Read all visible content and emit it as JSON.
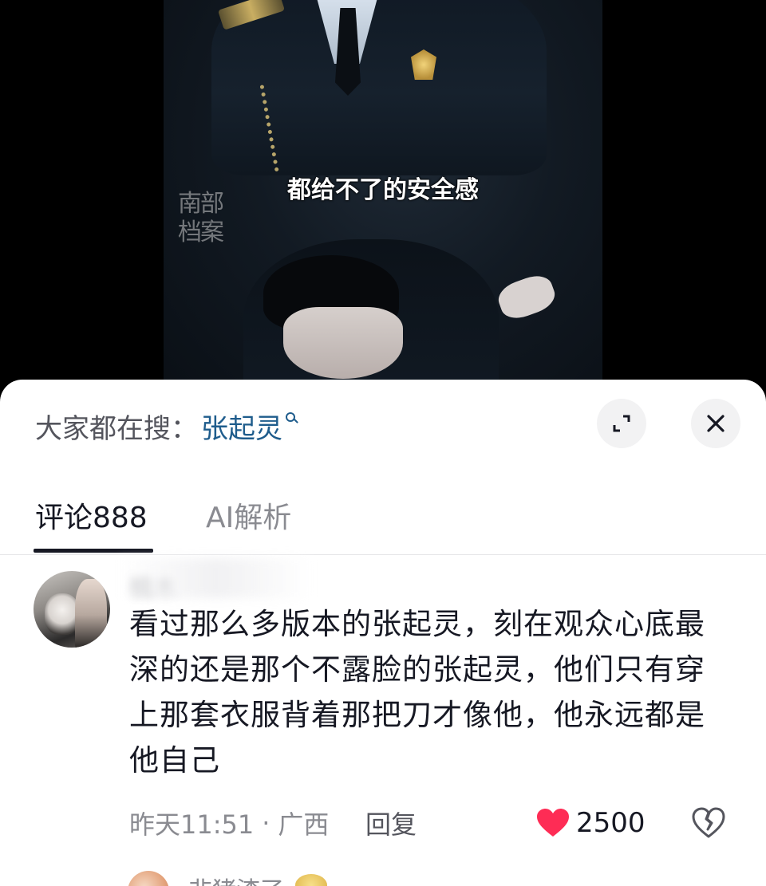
{
  "video": {
    "subtitle": "都给不了的安全感",
    "watermark": "南部档案"
  },
  "sheet": {
    "search_prefix": "大家都在搜：",
    "search_keyword": "张起灵",
    "tabs": [
      {
        "label": "评论888",
        "active": true
      },
      {
        "label": "AI解析",
        "active": false
      }
    ]
  },
  "comment": {
    "username": "楠木",
    "text": "看过那么多版本的张起灵，刻在观众心底最深的还是那个不露脸的张起灵，他们只有穿上那套衣服背着那把刀才像他，他永远都是他自己",
    "time": "昨天11:51",
    "separator": "·",
    "location": "广西",
    "reply_label": "回复",
    "like_count": "2500",
    "liked": true
  },
  "next_comment": {
    "username": "非猪渣了"
  },
  "colors": {
    "accent_link": "#1e5c8c",
    "like_red": "#fe2c55",
    "text_primary": "#161823",
    "text_secondary": "#8a8b91"
  },
  "icons": [
    "search-icon",
    "expand-icon",
    "close-icon",
    "heart-icon",
    "broken-heart-icon"
  ]
}
